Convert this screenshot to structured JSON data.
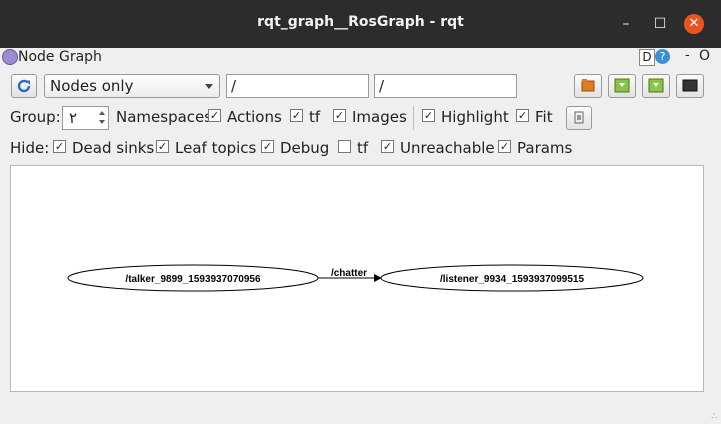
{
  "window": {
    "title": "rqt_graph__RosGraph - rqt",
    "close_glyph": "✕",
    "min_glyph": "–",
    "max_glyph": "☐"
  },
  "panel": {
    "title": "Node Graph",
    "d_label": "D",
    "help_label": "?",
    "dash": "-",
    "o": "O"
  },
  "toolbar": {
    "mode_selected": "Nodes only",
    "filter1": "/",
    "filter2": "/"
  },
  "options": {
    "group_label": "Group:",
    "group_value": "۲",
    "namespaces": "Namespaces",
    "actions": "Actions",
    "tf": "tf",
    "images": "Images",
    "highlight": "Highlight",
    "fit": "Fit"
  },
  "hide": {
    "label": "Hide:",
    "dead_sinks": "Dead sinks",
    "leaf_topics": "Leaf topics",
    "debug": "Debug",
    "tf": "tf",
    "unreachable": "Unreachable",
    "params": "Params"
  },
  "checks": {
    "on": "✓"
  },
  "graph": {
    "nodes": [
      {
        "name": "/talker_9899_1593937070956"
      },
      {
        "name": "/listener_9934_1593937099515"
      }
    ],
    "edges": [
      {
        "label": "/chatter"
      }
    ]
  },
  "grip": "∴"
}
